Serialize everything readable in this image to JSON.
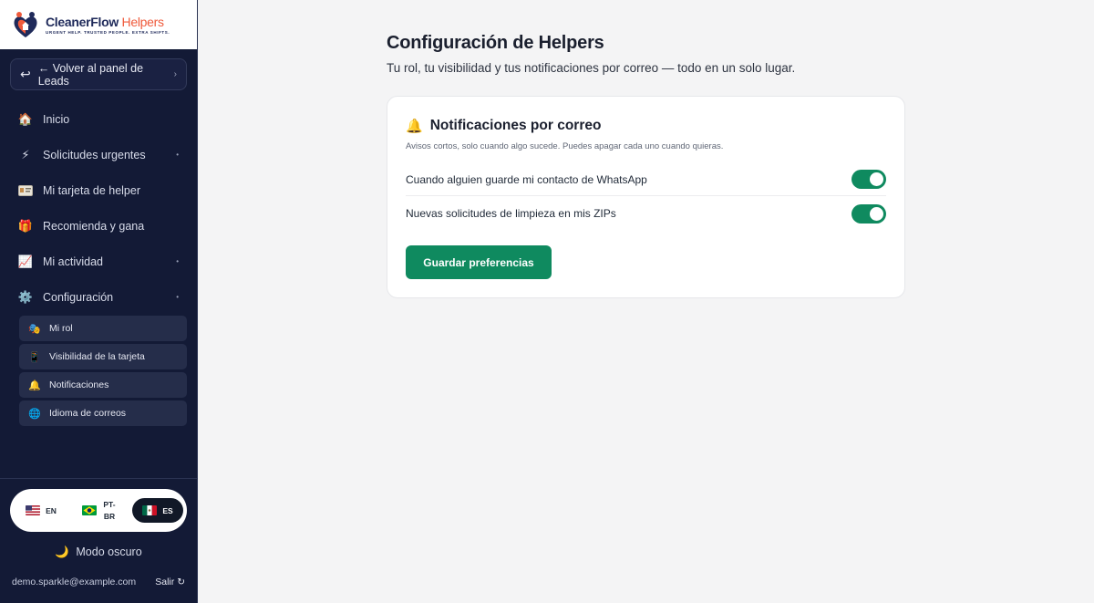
{
  "brand": {
    "name_primary": "CleanerFlow",
    "name_accent": "Helpers",
    "tagline": "URGENT HELP. TRUSTED PEOPLE. EXTRA SHIFTS."
  },
  "sidebar": {
    "back_label": "← Volver al panel de Leads",
    "items": [
      {
        "label": "Inicio",
        "icon": "house-icon"
      },
      {
        "label": "Solicitudes urgentes",
        "icon": "lightning-icon"
      },
      {
        "label": "Mi tarjeta de helper",
        "icon": "id-card-icon"
      },
      {
        "label": "Recomienda y gana",
        "icon": "gift-icon"
      },
      {
        "label": "Mi actividad",
        "icon": "chart-icon"
      },
      {
        "label": "Configuración",
        "icon": "gear-icon"
      }
    ],
    "sub_items": [
      {
        "label": "Mi rol",
        "icon": "role-icon"
      },
      {
        "label": "Visibilidad de la tarjeta",
        "icon": "phone-icon"
      },
      {
        "label": "Notificaciones",
        "icon": "bell-icon"
      },
      {
        "label": "Idioma de correos",
        "icon": "globe-icon"
      }
    ],
    "languages": {
      "en": "EN",
      "pt_line1": "PT-",
      "pt_line2": "BR",
      "es": "ES",
      "selected": "ES"
    },
    "dark_mode_label": "Modo oscuro",
    "user_email": "demo.sparkle@example.com",
    "logout_label": "Salir"
  },
  "main": {
    "title": "Configuración de Helpers",
    "subtitle": "Tu rol, tu visibilidad y tus notificaciones por correo — todo en un solo lugar.",
    "card": {
      "title": "Notificaciones por correo",
      "description": "Avisos cortos, solo cuando algo sucede. Puedes apagar cada uno cuando quieras.",
      "preferences": [
        {
          "label": "Cuando alguien guarde mi contacto de WhatsApp",
          "enabled": true
        },
        {
          "label": "Nuevas solicitudes de limpieza en mis ZIPs",
          "enabled": true
        }
      ],
      "save_label": "Guardar preferencias"
    }
  },
  "colors": {
    "sidebar_bg": "#131a36",
    "accent_green": "#0f8a5f",
    "brand_orange": "#ef5a3b"
  }
}
